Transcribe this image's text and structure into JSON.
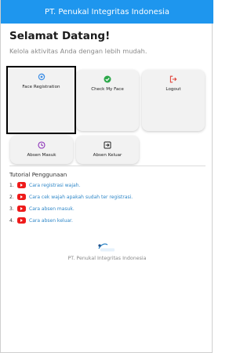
{
  "app": {
    "title": "PT. Penukal Integritas Indonesia"
  },
  "greeting": "Selamat Datang!",
  "subtitle": "Kelola aktivitas Anda dengan lebih mudah.",
  "menu": [
    {
      "label": "Face Registration",
      "icon": "face-registration-icon",
      "color": "#3f8fe6"
    },
    {
      "label": "Check My Face",
      "icon": "check-circle-icon",
      "color": "#2ca84a"
    },
    {
      "label": "Logout",
      "icon": "logout-icon",
      "color": "#e0463c"
    },
    {
      "label": "Absen Masuk",
      "icon": "clock-icon",
      "color": "#8b2fb8"
    },
    {
      "label": "Absen Keluar",
      "icon": "exit-icon",
      "color": "#222222"
    }
  ],
  "tutorial": {
    "title": "Tutorial Penggunaan",
    "items": [
      {
        "num": "1.",
        "text": "Cara registrasi wajah."
      },
      {
        "num": "2.",
        "text": "Cara cek wajah apakah sudah ter registrasi."
      },
      {
        "num": "3.",
        "text": "Cara absen masuk."
      },
      {
        "num": "4.",
        "text": "Cara absen keluar."
      }
    ]
  },
  "footer": {
    "company": "PT. Penukal Integritas Indonesia",
    "logo_text": "Penukal"
  },
  "colors": {
    "appbar": "#1e96ee",
    "youtube": "#ee1b1b",
    "link": "#2f87c8"
  }
}
